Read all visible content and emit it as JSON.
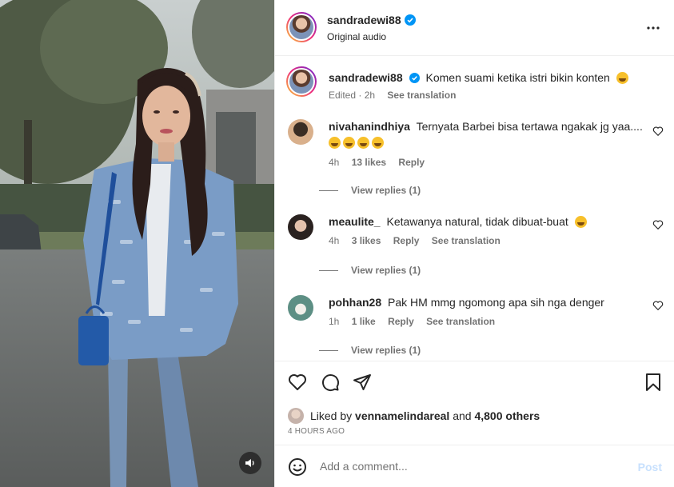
{
  "post": {
    "username": "sandradewi88",
    "audio": "Original audio",
    "caption": "Komen suami ketika istri bikin konten",
    "caption_edited": "Edited · 2h",
    "see_translation": "See translation"
  },
  "comments": [
    {
      "username": "nivahanindhiya",
      "text": "Ternyata Barbei bisa tertawa ngakak jg yaa....",
      "time": "4h",
      "likes": "13 likes",
      "reply": "Reply",
      "view_replies": "View replies (1)"
    },
    {
      "username": "meaulite_",
      "text": "Ketawanya natural, tidak dibuat-buat",
      "time": "4h",
      "likes": "3 likes",
      "reply": "Reply",
      "see_translation": "See translation",
      "view_replies": "View replies (1)"
    },
    {
      "username": "pohhan28",
      "text": "Pak HM mmg ngomong apa sih nga denger",
      "time": "1h",
      "likes": "1 like",
      "reply": "Reply",
      "see_translation": "See translation",
      "view_replies": "View replies (1)"
    }
  ],
  "likes_line": {
    "prefix": "Liked by",
    "user": "vennamelindareal",
    "and": "and",
    "others": "4,800 others"
  },
  "timestamp": "4 HOURS AGO",
  "add_comment": {
    "placeholder": "Add a comment...",
    "post_label": "Post"
  },
  "icons": [
    "heart-icon",
    "comment-icon",
    "share-icon",
    "bookmark-icon",
    "verified-icon",
    "more-icon",
    "emoji-icon",
    "speaker-icon"
  ],
  "colors": {
    "verified": "#0095f6",
    "muted": "#737373",
    "post_disabled": "#c7e0fd"
  }
}
